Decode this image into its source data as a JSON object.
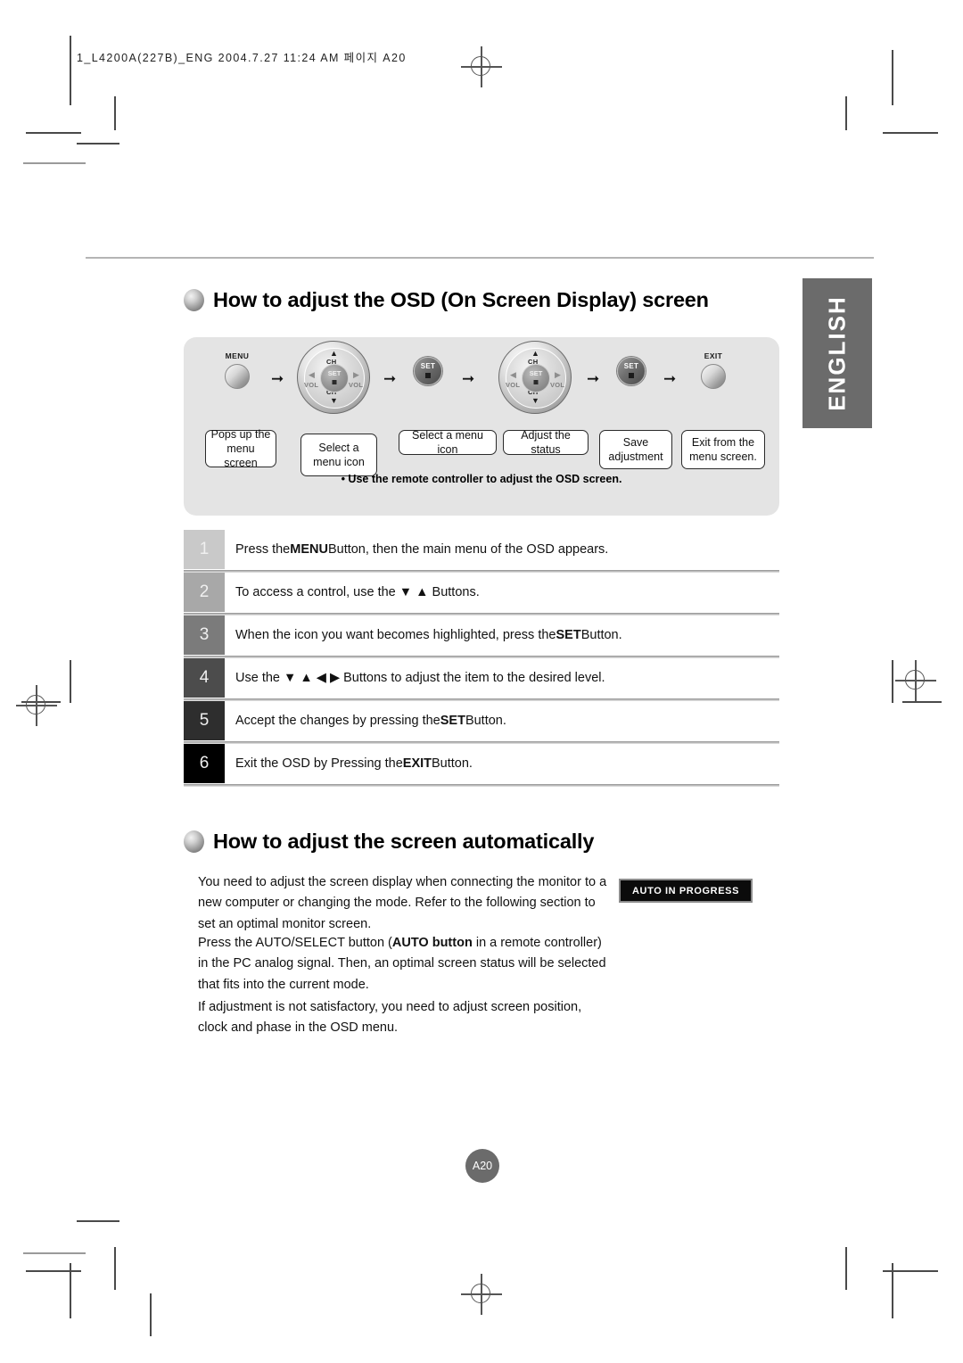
{
  "header": {
    "slug": "1_L4200A(227B)_ENG  2004.7.27 11:24 AM  페이지 A20"
  },
  "lang_tab": {
    "label": "ENGLISH"
  },
  "section_osd": {
    "heading": "How to adjust the OSD (On Screen Display) screen",
    "diagram": {
      "note": "• Use the remote controller to adjust the OSD screen.",
      "arrow_glyph": "➞",
      "buttons": [
        {
          "name": "menu",
          "cap": "MENU",
          "type": "round"
        },
        {
          "name": "dpad-1",
          "cap": "",
          "type": "dpad"
        },
        {
          "name": "set-1",
          "cap": "",
          "type": "set"
        },
        {
          "name": "dpad-2",
          "cap": "",
          "type": "dpad"
        },
        {
          "name": "set-2",
          "cap": "",
          "type": "set"
        },
        {
          "name": "exit",
          "cap": "EXIT",
          "type": "round"
        }
      ],
      "dpad_labels": {
        "up_label": "CH",
        "down_label": "CH",
        "left_label": "VOL",
        "right_label": "VOL",
        "center_label": "SET",
        "up_arrow": "▲",
        "down_arrow": "▼",
        "left_arrow": "◀",
        "right_arrow": "▶"
      },
      "set_label": "SET",
      "callouts": [
        "Pops up the menu screen",
        "Select a menu icon",
        "Select a menu icon",
        "Adjust the status",
        "Save adjustment",
        "Exit from the menu screen."
      ]
    },
    "steps": [
      {
        "num": "1",
        "box_color": "#c9c9c9",
        "text_pre": "Press the ",
        "bold": "MENU",
        "text_post": " Button, then the main menu of the OSD appears."
      },
      {
        "num": "2",
        "box_color": "#a8a8a8",
        "text_pre": "To access a control, use the  ▼ ▲ Buttons.",
        "bold": "",
        "text_post": ""
      },
      {
        "num": "3",
        "box_color": "#7b7b7b",
        "text_pre": "When the icon you want becomes highlighted, press the ",
        "bold": "SET",
        "text_post": " Button."
      },
      {
        "num": "4",
        "box_color": "#4c4c4c",
        "text_pre": "Use the  ▼ ▲ ◀ ▶ Buttons to adjust the item to the desired level.",
        "bold": "",
        "text_post": ""
      },
      {
        "num": "5",
        "box_color": "#2e2e2e",
        "text_pre": "Accept the changes by pressing the ",
        "bold": "SET",
        "text_post": " Button."
      },
      {
        "num": "6",
        "box_color": "#000000",
        "text_pre": "Exit the OSD by Pressing the ",
        "bold": "EXIT",
        "text_post": " Button."
      }
    ]
  },
  "section_auto": {
    "heading": "How to adjust the screen automatically",
    "paragraph_1": "You need to adjust the screen display when connecting the monitor to a new computer or changing the mode. Refer to the following section to set an optimal monitor screen.",
    "paragraph_2_pre": "Press the AUTO/SELECT button (",
    "paragraph_2_bold": "AUTO button",
    "paragraph_2_post": " in a remote controller) in the PC analog signal. Then, an optimal screen status will be selected that fits into the current mode.",
    "paragraph_3": "If adjustment is not satisfactory, you need to adjust screen position, clock and phase in the OSD menu.",
    "osd_badge": "AUTO IN PROGRESS"
  },
  "footer": {
    "page_number": "A20"
  }
}
